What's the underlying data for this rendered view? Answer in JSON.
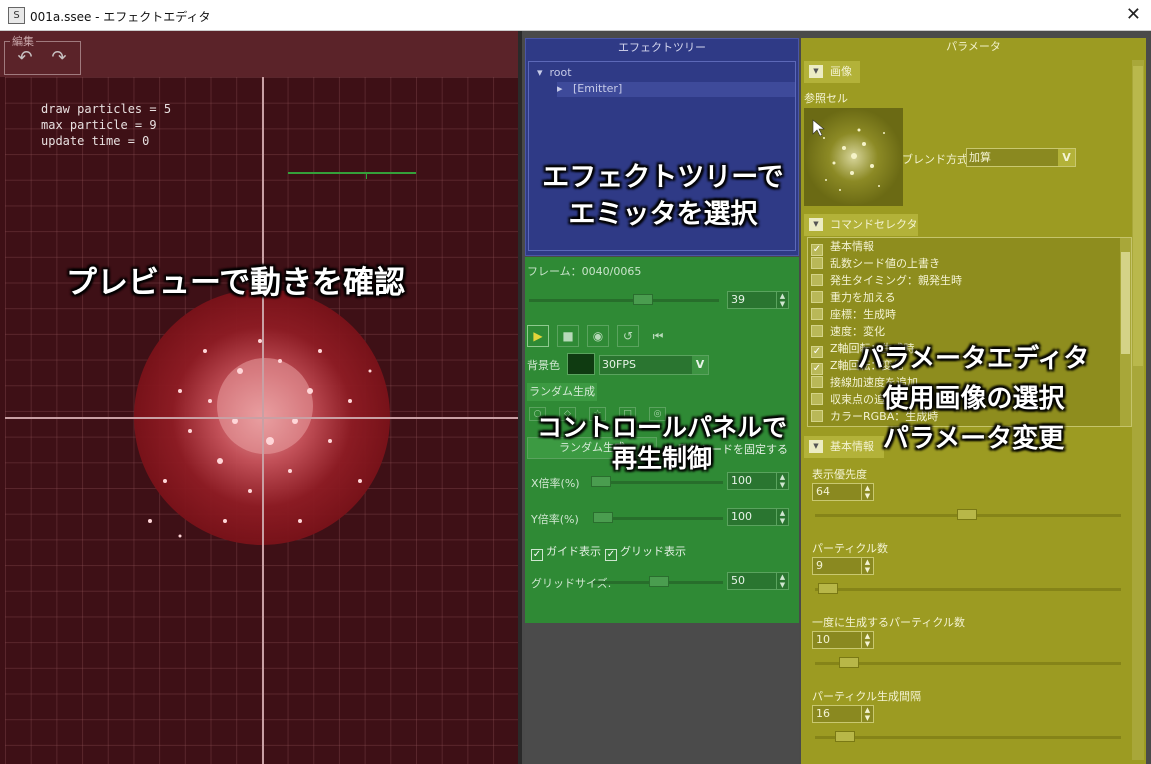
{
  "window": {
    "title": "001a.ssee - エフェクトエディタ",
    "close_glyph": "✕"
  },
  "preview": {
    "edit_label": "編集",
    "undo_glyph": "↶",
    "redo_glyph": "↷",
    "stats": [
      "draw particles = 5",
      "max particle = 9",
      "update time = 0"
    ],
    "annotation": "プレビューで動きを確認"
  },
  "tree": {
    "header": "エフェクトツリー",
    "root": "root",
    "emitter": "[Emitter]",
    "annotation_line1": "エフェクトツリーで",
    "annotation_line2": "エミッタを選択"
  },
  "control": {
    "frame": "フレーム：0040/0065",
    "frame_value": "39",
    "bg_label": "背景色",
    "fps": "30FPS",
    "random_tab": "ランダム生成",
    "random_button": "ランダム生成",
    "fix_seed": "乱数シードを固定する",
    "x_scale_label": "X倍率(%)",
    "x_scale": "100",
    "y_scale_label": "Y倍率(%)",
    "y_scale": "100",
    "guide": "ガイド表示",
    "grid": "グリッド表示",
    "grid_size_label": "グリッドサイズ:",
    "grid_size": "50",
    "annotation_line1": "コントロールパネルで",
    "annotation_line2": "再生制御"
  },
  "param": {
    "header": "パラメータ",
    "section_image": "画像",
    "ref_cell": "参照セル",
    "blend_label": "ブレンド方式",
    "blend_value": "加算",
    "section_cmd": "コマンドセレクター",
    "commands": [
      {
        "label": "基本情報",
        "checked": "✓"
      },
      {
        "label": "乱数シード値の上書き",
        "checked": ""
      },
      {
        "label": "発生タイミング：親発生時",
        "checked": ""
      },
      {
        "label": "重力を加える",
        "checked": ""
      },
      {
        "label": "座標：生成時",
        "checked": ""
      },
      {
        "label": "速度：変化",
        "checked": ""
      },
      {
        "label": "Z軸回転：生成時",
        "checked": "✓"
      },
      {
        "label": "Z軸回転：変化",
        "checked": "✓"
      },
      {
        "label": "接線加速度を追加",
        "checked": ""
      },
      {
        "label": "収束点の追加",
        "checked": ""
      },
      {
        "label": "カラーRGBA：生成時",
        "checked": ""
      }
    ],
    "section_basic": "基本情報",
    "priority_label": "表示優先度",
    "priority": "64",
    "count_label": "パーティクル数",
    "count": "9",
    "once_label": "一度に生成するパーティクル数",
    "once": "10",
    "interval_label": "パーティクル生成間隔",
    "interval": "16",
    "annotation_line1": "パラメータエディタ",
    "annotation_line2": "使用画像の選択",
    "annotation_line3": "パラメータ変更"
  },
  "colors": {
    "preview_bg": "#3e1016",
    "tree_bg": "#2f3a86",
    "control_bg": "#2f8a35",
    "param_bg": "#9c9b22"
  }
}
